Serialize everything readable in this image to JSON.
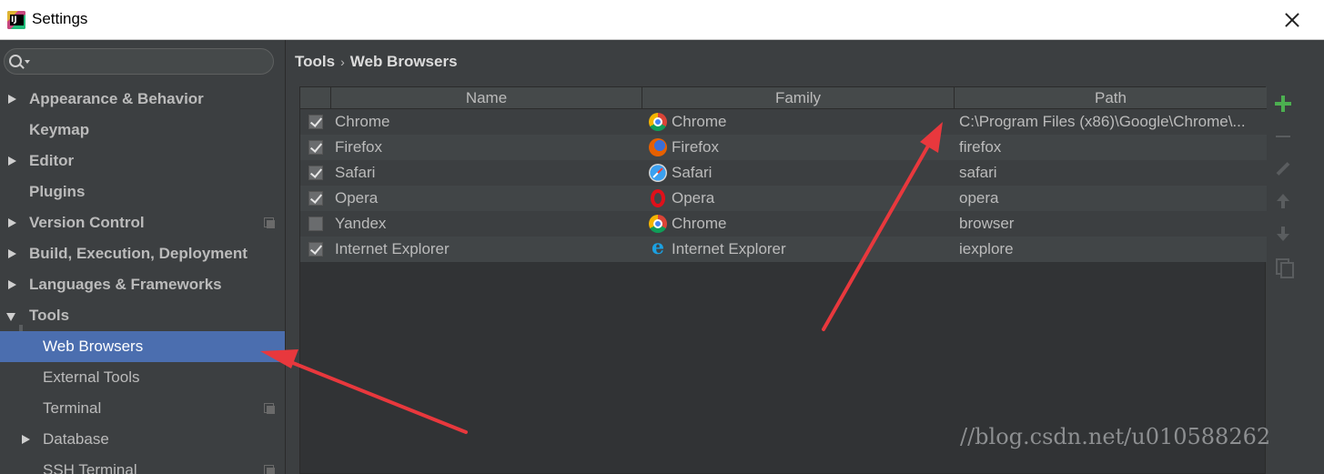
{
  "window": {
    "title": "Settings",
    "close_icon": "close-icon"
  },
  "search": {
    "value": "",
    "placeholder": "",
    "icon": "search-icon"
  },
  "sidebar": {
    "items": [
      {
        "label": "Appearance & Behavior",
        "arrow": "right",
        "bold": true
      },
      {
        "label": "Keymap",
        "arrow": null,
        "bold": true
      },
      {
        "label": "Editor",
        "arrow": "right",
        "bold": true
      },
      {
        "label": "Plugins",
        "arrow": null,
        "bold": true
      },
      {
        "label": "Version Control",
        "arrow": "right",
        "bold": true,
        "project_icon": true
      },
      {
        "label": "Build, Execution, Deployment",
        "arrow": "right",
        "bold": true
      },
      {
        "label": "Languages & Frameworks",
        "arrow": "right",
        "bold": true
      },
      {
        "label": "Tools",
        "arrow": "down",
        "bold": true
      },
      {
        "label": "Web Browsers",
        "selected": true
      },
      {
        "label": "External Tools"
      },
      {
        "label": "Terminal",
        "project_icon": true
      },
      {
        "label": "Database",
        "arrow": "right"
      },
      {
        "label": "SSH Terminal"
      }
    ]
  },
  "breadcrumb": {
    "parts": [
      "Tools",
      "Web Browsers"
    ],
    "separator": "›"
  },
  "table": {
    "columns": [
      "Name",
      "Family",
      "Path"
    ],
    "rows": [
      {
        "checked": true,
        "name": "Chrome",
        "family": "Chrome",
        "family_icon": "chrome-icon",
        "path": "C:\\Program Files (x86)\\Google\\Chrome\\..."
      },
      {
        "checked": true,
        "name": "Firefox",
        "family": "Firefox",
        "family_icon": "firefox-icon",
        "path": "firefox"
      },
      {
        "checked": true,
        "name": "Safari",
        "family": "Safari",
        "family_icon": "safari-icon",
        "path": "safari"
      },
      {
        "checked": true,
        "name": "Opera",
        "family": "Opera",
        "family_icon": "opera-icon",
        "path": "opera"
      },
      {
        "checked": false,
        "name": "Yandex",
        "family": "Chrome",
        "family_icon": "chrome-icon",
        "path": "browser"
      },
      {
        "checked": true,
        "name": "Internet Explorer",
        "family": "Internet Explorer",
        "family_icon": "internet-explorer-icon",
        "path": "iexplore"
      }
    ]
  },
  "toolbar": {
    "buttons": [
      "add-icon",
      "remove-icon",
      "edit-icon",
      "move-up-icon",
      "move-down-icon",
      "copy-icon"
    ]
  },
  "watermark": "//blog.csdn.net/u010588262",
  "colors": {
    "background": "#3c3f41",
    "selection": "#4b6eaf",
    "add_button": "#4caf50",
    "annotation_arrow": "#e8383d"
  }
}
